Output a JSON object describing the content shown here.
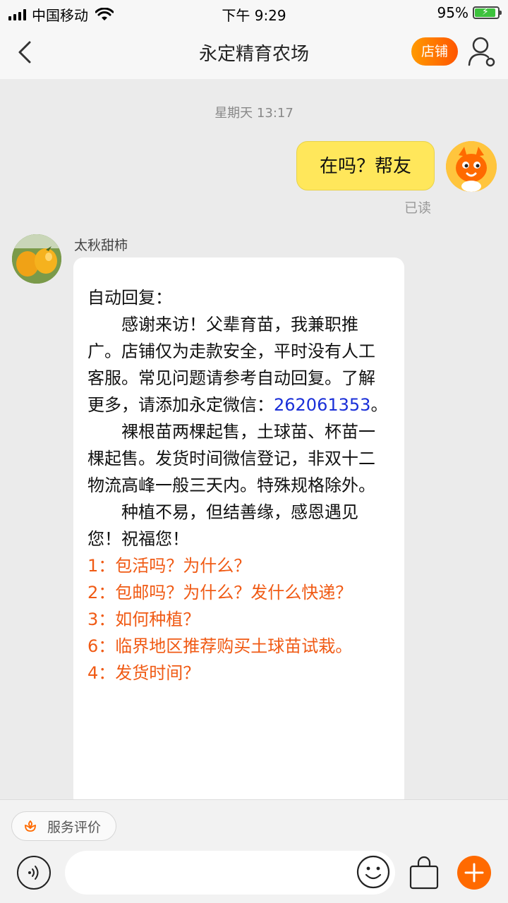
{
  "status_bar": {
    "carrier": "中国移动",
    "time": "下午 9:29",
    "battery": "95%"
  },
  "nav": {
    "title": "永定精育农场",
    "shop_label": "店铺"
  },
  "chat": {
    "timestamp": "星期天 13:17",
    "my_message": "在吗？帮友",
    "read_status": "已读",
    "sender_name": "太秋甜柿",
    "auto_reply": {
      "heading": "自动回复：",
      "para1_before": "感谢来访！父辈育苗，我兼职推广。店铺仅为走款安全，平时没有人工客服。常见问题请参考自动回复。了解更多，请添加永定微信：",
      "para1_wechat": "262061353",
      "para1_after": "。",
      "para2": "裸根苗两棵起售，土球苗、杯苗一棵起售。发货时间微信登记，非双十二物流高峰一般三天内。特殊规格除外。",
      "para3": "种植不易，但结善缘，感恩遇见您！祝福您！",
      "menu": [
        "1：包活吗？为什么？",
        "2：包邮吗？为什么？发什么快递？",
        "3：如何种植？",
        "6：临界地区推荐购买土球苗试栽。",
        "4：发货时间？"
      ]
    }
  },
  "bottom": {
    "rating_label": "服务评价",
    "input_placeholder": ""
  },
  "colors": {
    "accent": "#ff6a00",
    "my_bubble": "#ffe75b",
    "menu_link": "#f05a14",
    "wechat_link": "#1a2fd8"
  }
}
